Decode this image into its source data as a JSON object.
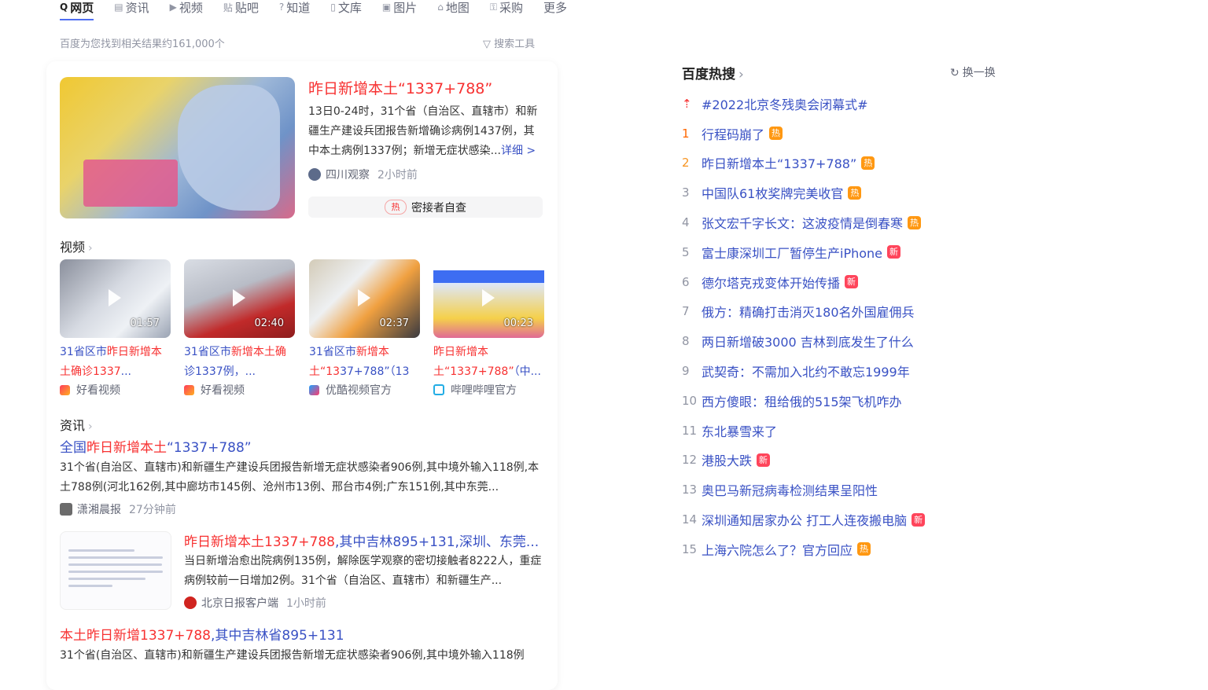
{
  "tabs": [
    {
      "icon": "search-icon",
      "glyph": "Q",
      "label": "网页",
      "active": true
    },
    {
      "icon": "news-icon",
      "glyph": "▤",
      "label": "资讯"
    },
    {
      "icon": "video-icon",
      "glyph": "▶",
      "label": "视频"
    },
    {
      "icon": "tieba-icon",
      "glyph": "贴",
      "label": "贴吧"
    },
    {
      "icon": "question-icon",
      "glyph": "?",
      "label": "知道"
    },
    {
      "icon": "document-icon",
      "glyph": "▯",
      "label": "文库"
    },
    {
      "icon": "image-icon",
      "glyph": "▣",
      "label": "图片"
    },
    {
      "icon": "map-icon",
      "glyph": "⌂",
      "label": "地图"
    },
    {
      "icon": "cart-icon",
      "glyph": "⚿",
      "label": "采购"
    },
    {
      "icon": "",
      "glyph": "",
      "label": "更多"
    }
  ],
  "result_count": "百度为您找到相关结果约161,000个",
  "search_tool": "搜索工具",
  "top_result": {
    "title": "昨日新增本土“1337+788”",
    "abstract": "13日0-24时，31个省（自治区、直辖市）和新疆生产建设兵团报告新增确诊病例1437例，其中本土病例1337例；新增无症状感染...",
    "more": "详细 >",
    "source": "四川观察",
    "time": "2小时前",
    "hot_tag": "热",
    "action": "密接者自查"
  },
  "videos_heading": "视频",
  "videos": [
    {
      "duration": "01:57",
      "pre": "31省区市",
      "em": "昨日新增本土确诊1337",
      "post": "...",
      "source": "好看视频"
    },
    {
      "duration": "02:40",
      "pre": "31省区市",
      "em": "新增本土确",
      "post": "诊1337例，...",
      "source": "好看视频"
    },
    {
      "duration": "02:37",
      "pre": "31省区市",
      "em": "新增本土“13",
      "post": "37+788”（13",
      "source": "优酷视频官方"
    },
    {
      "duration": "00:23",
      "pre": "",
      "em": "昨日新增本土“1337+788”",
      "post": "（中...",
      "source": "哔哩哔哩官方"
    }
  ],
  "news_heading": "资讯",
  "news": [
    {
      "title_pre": "全国",
      "title_em": "昨日新增本土",
      "title_post": "“1337+788”",
      "abstract": "31个省(自治区、直辖市)和新疆生产建设兵团报告新增无症状感染者906例,其中境外输入118例,本土788例(河北162例,其中廊坊市145例、沧州市13例、邢台市4例;广东151例,其中东莞...",
      "source": "潇湘晨报",
      "time": "27分钟前"
    },
    {
      "title_em": "昨日新增本土1337+788",
      "title_post": ",其中吉林895+131,深圳、东莞...",
      "abstract": "当日新增治愈出院病例135例，解除医学观察的密切接触者8222人，重症病例较前一日增加2例。31个省（自治区、直辖市）和新疆生产...",
      "source": "北京日报客户端",
      "time": "1小时前"
    },
    {
      "title_em": "本土昨日新增1337+788",
      "title_post": ",其中吉林省895+131",
      "abstract": "31个省(自治区、直辖市)和新疆生产建设兵团报告新增无症状感染者906例,其中境外输入118例"
    }
  ],
  "hot": {
    "heading": "百度热搜",
    "refresh": "换一换",
    "items": [
      {
        "idx": "⇡",
        "title": "#2022北京冬残奥会闭幕式#",
        "badge": ""
      },
      {
        "idx": "1",
        "title": "行程码崩了",
        "badge": "热"
      },
      {
        "idx": "2",
        "title": "昨日新增本土“1337+788”",
        "badge": "热"
      },
      {
        "idx": "3",
        "title": "中国队61枚奖牌完美收官",
        "badge": "热"
      },
      {
        "idx": "4",
        "title": "张文宏千字长文：这波疫情是倒春寒",
        "badge": "热"
      },
      {
        "idx": "5",
        "title": "富士康深圳工厂暂停生产iPhone",
        "badge": "新"
      },
      {
        "idx": "6",
        "title": "德尔塔克戎变体开始传播",
        "badge": "新"
      },
      {
        "idx": "7",
        "title": "俄方：精确打击消灭180名外国雇佣兵",
        "badge": ""
      },
      {
        "idx": "8",
        "title": "两日新增破3000 吉林到底发生了什么",
        "badge": ""
      },
      {
        "idx": "9",
        "title": "武契奇：不需加入北约不敢忘1999年",
        "badge": ""
      },
      {
        "idx": "10",
        "title": "西方傻眼：租给俄的515架飞机咋办",
        "badge": ""
      },
      {
        "idx": "11",
        "title": "东北暴雪来了",
        "badge": ""
      },
      {
        "idx": "12",
        "title": "港股大跌",
        "badge": "新"
      },
      {
        "idx": "13",
        "title": "奥巴马新冠病毒检测结果呈阳性",
        "badge": ""
      },
      {
        "idx": "14",
        "title": "深圳通知居家办公 打工人连夜搬电脑",
        "badge": "新"
      },
      {
        "idx": "15",
        "title": "上海六院怎么了？官方回应",
        "badge": "热"
      }
    ]
  },
  "colors": {
    "accent": "#4e6ef2",
    "link": "#3951c4",
    "highlight": "#f73131",
    "hot_badge": "#ff9812",
    "new_badge": "#ff455b"
  }
}
